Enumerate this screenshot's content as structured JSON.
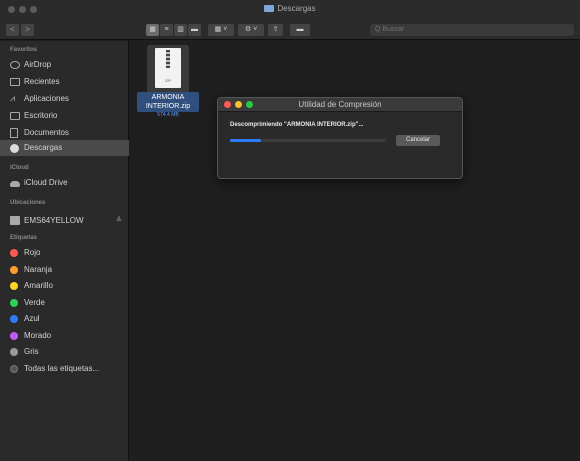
{
  "window": {
    "title": "Descargas"
  },
  "toolbar": {
    "back": "<",
    "forward": ">",
    "view_icons": "▦",
    "view_list": "≡",
    "view_columns": "▥",
    "view_gallery": "▬",
    "group": "▦ ˅",
    "action": "⚙ ˅",
    "share": "⇪",
    "tag": "▬",
    "search_placeholder": "Q Buscar"
  },
  "sidebar": {
    "favorites_title": "Favoritos",
    "favorites": [
      {
        "label": "AirDrop",
        "icon": "airdrop-icon"
      },
      {
        "label": "Recientes",
        "icon": "clock-icon"
      },
      {
        "label": "Aplicaciones",
        "icon": "apps-icon"
      },
      {
        "label": "Escritorio",
        "icon": "desktop-icon"
      },
      {
        "label": "Documentos",
        "icon": "document-icon"
      },
      {
        "label": "Descargas",
        "icon": "download-icon",
        "selected": true
      }
    ],
    "icloud_title": "iCloud",
    "icloud": [
      {
        "label": "iCloud Drive",
        "icon": "cloud-icon"
      }
    ],
    "locations_title": "Ubicaciones",
    "locations": [
      {
        "label": "EMS64YELLOW",
        "icon": "drive-icon",
        "eject": "≜"
      }
    ],
    "tags_title": "Etiquetas",
    "tags": [
      {
        "label": "Rojo",
        "color": "#ff5a52"
      },
      {
        "label": "Naranja",
        "color": "#ff9a2e"
      },
      {
        "label": "Amarillo",
        "color": "#ffd426"
      },
      {
        "label": "Verde",
        "color": "#2ed158"
      },
      {
        "label": "Azul",
        "color": "#2f7df6"
      },
      {
        "label": "Morado",
        "color": "#bf5af2"
      },
      {
        "label": "Gris",
        "color": "#9a9a9a"
      },
      {
        "label": "Todas las etiquetas...",
        "color": "#555555"
      }
    ]
  },
  "file": {
    "icon_text": "ZIP",
    "name_line1": "ARMONIA",
    "name_line2": "INTERIOR.zip",
    "size": "574.4 MB"
  },
  "dialog": {
    "title": "Utilidad de Compresión",
    "message": "Descomprimiendo \"ARMONIA INTERIOR.zip\"...",
    "progress": 0.2,
    "cancel_label": "Cancelar",
    "dot_colors": [
      "#ff5a52",
      "#ffbd2e",
      "#28c840"
    ]
  }
}
